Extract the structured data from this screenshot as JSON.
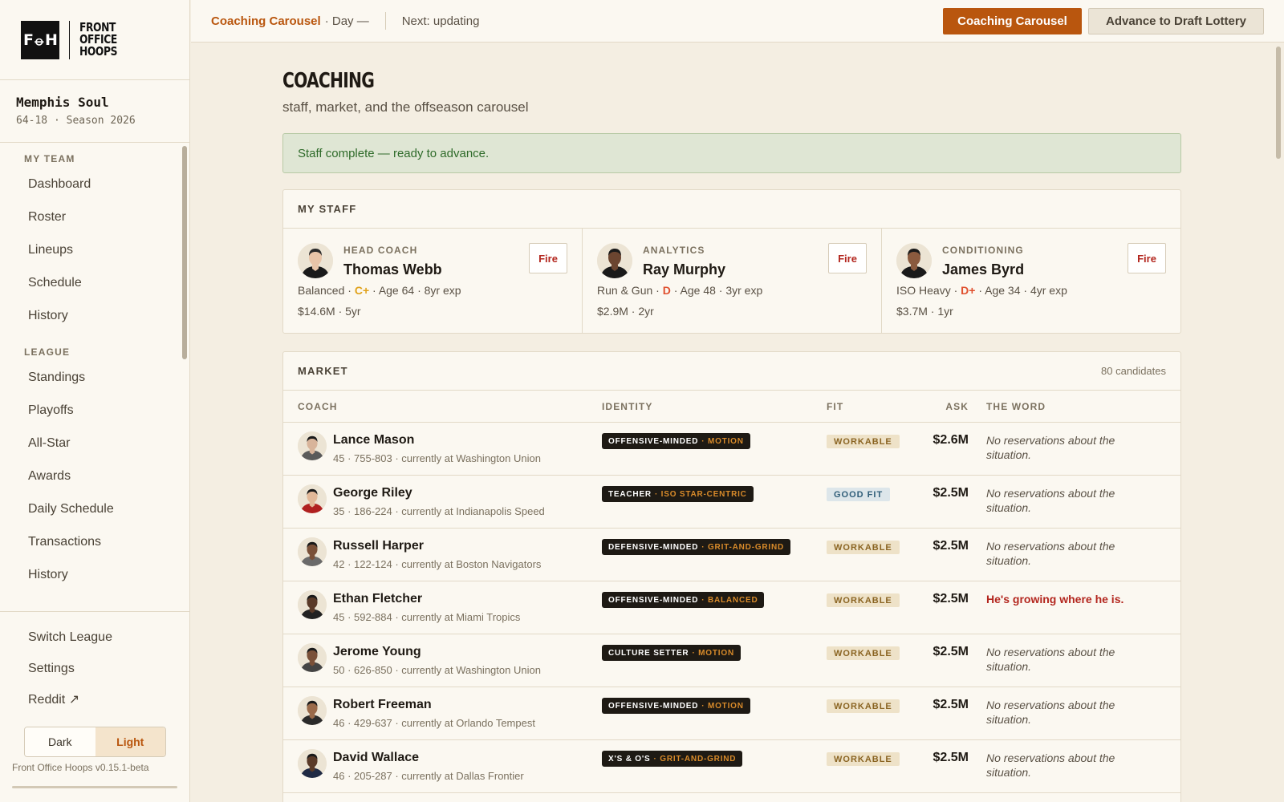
{
  "brand": {
    "mark": "F⦵H",
    "line1": "FRONT",
    "line2": "OFFICE",
    "line3": "HOOPS"
  },
  "team": {
    "name": "Memphis Soul",
    "record": "64-18 · Season 2026"
  },
  "nav": {
    "my_team_label": "MY TEAM",
    "my_team": [
      "Dashboard",
      "Roster",
      "Lineups",
      "Schedule",
      "History"
    ],
    "league_label": "LEAGUE",
    "league": [
      "Standings",
      "Playoffs",
      "All-Star",
      "Awards",
      "Daily Schedule",
      "Transactions",
      "History"
    ],
    "bottom": [
      "Switch League",
      "Settings",
      "Reddit ↗"
    ]
  },
  "theme": {
    "dark": "Dark",
    "light": "Light",
    "selected": "Light"
  },
  "version": "Front Office Hoops v0.15.1-beta",
  "topbar": {
    "phase": "Coaching Carousel",
    "day": "· Day —",
    "next": "Next: updating",
    "primary_button": "Coaching Carousel",
    "secondary_button": "Advance to Draft Lottery"
  },
  "page": {
    "title": "COACHING",
    "subtitle": "staff, market, and the offseason carousel",
    "alert": "Staff complete — ready to advance."
  },
  "staff": {
    "title": "MY STAFF",
    "fire_label": "Fire",
    "members": [
      {
        "role": "HEAD COACH",
        "name": "Thomas Webb",
        "style": "Balanced",
        "grade": "C+",
        "grade_color": "#e0a21b",
        "age": "Age 64",
        "exp": "8yr exp",
        "contract": "$14.6M · 5yr",
        "skin": "#e8c4a8",
        "hair": "#2a2a2a"
      },
      {
        "role": "ANALYTICS",
        "name": "Ray Murphy",
        "style": "Run & Gun",
        "grade": "D",
        "grade_color": "#e0502f",
        "age": "Age 48",
        "exp": "3yr exp",
        "contract": "$2.9M · 2yr",
        "skin": "#6b4530",
        "hair": "#1a1a1a"
      },
      {
        "role": "CONDITIONING",
        "name": "James Byrd",
        "style": "ISO Heavy",
        "grade": "D+",
        "grade_color": "#e0502f",
        "age": "Age 34",
        "exp": "4yr exp",
        "contract": "$3.7M · 1yr",
        "skin": "#8a5a3e",
        "hair": "#1a1a1a"
      }
    ]
  },
  "market": {
    "title": "MARKET",
    "count": "80 candidates",
    "columns": {
      "coach": "COACH",
      "identity": "IDENTITY",
      "fit": "FIT",
      "ask": "ASK",
      "word": "THE WORD"
    },
    "rows": [
      {
        "name": "Lance Mason",
        "meta": "45 · 755-803 · currently at Washington Union",
        "identity": "OFFENSIVE-MINDED",
        "identity_sub": "· MOTION",
        "fit": "WORKABLE",
        "ask": "$2.6M",
        "word": "No reservations about the situation.",
        "word_alert": false,
        "skin": "#d8b49a",
        "shirt": "#5a5a5a"
      },
      {
        "name": "George Riley",
        "meta": "35 · 186-224 · currently at Indianapolis Speed",
        "identity": "TEACHER",
        "identity_sub": "· ISO STAR-CENTRIC",
        "fit": "GOOD FIT",
        "ask": "$2.5M",
        "word": "No reservations about the situation.",
        "word_alert": false,
        "skin": "#e2b898",
        "shirt": "#b02020"
      },
      {
        "name": "Russell Harper",
        "meta": "42 · 122-124 · currently at Boston Navigators",
        "identity": "DEFENSIVE-MINDED",
        "identity_sub": "· GRIT-AND-GRIND",
        "fit": "WORKABLE",
        "ask": "$2.5M",
        "word": "No reservations about the situation.",
        "word_alert": false,
        "skin": "#7a5038",
        "shirt": "#6a6a6a"
      },
      {
        "name": "Ethan Fletcher",
        "meta": "45 · 592-884 · currently at Miami Tropics",
        "identity": "OFFENSIVE-MINDED",
        "identity_sub": "· BALANCED",
        "fit": "WORKABLE",
        "ask": "$2.5M",
        "word": "He's growing where he is.",
        "word_alert": true,
        "skin": "#5a3a28",
        "shirt": "#222222"
      },
      {
        "name": "Jerome Young",
        "meta": "50 · 626-850 · currently at Washington Union",
        "identity": "CULTURE SETTER",
        "identity_sub": "· MOTION",
        "fit": "WORKABLE",
        "ask": "$2.5M",
        "word": "No reservations about the situation.",
        "word_alert": false,
        "skin": "#7a5038",
        "shirt": "#444444"
      },
      {
        "name": "Robert Freeman",
        "meta": "46 · 429-637 · currently at Orlando Tempest",
        "identity": "OFFENSIVE-MINDED",
        "identity_sub": "· MOTION",
        "fit": "WORKABLE",
        "ask": "$2.5M",
        "word": "No reservations about the situation.",
        "word_alert": false,
        "skin": "#9a6a4a",
        "shirt": "#2a2a2a"
      },
      {
        "name": "David Wallace",
        "meta": "46 · 205-287 · currently at Dallas Frontier",
        "identity": "X'S & O'S",
        "identity_sub": "· GRIT-AND-GRIND",
        "fit": "WORKABLE",
        "ask": "$2.5M",
        "word": "No reservations about the situation.",
        "word_alert": false,
        "skin": "#5a3a28",
        "shirt": "#1f2a44"
      }
    ]
  },
  "colors": {
    "accent": "#b9560e",
    "background": "#f4eee2",
    "panel": "#fbf8f1",
    "alert_bg": "#dfe6d4",
    "alert_text": "#2f6b2a",
    "danger": "#b3261e"
  }
}
